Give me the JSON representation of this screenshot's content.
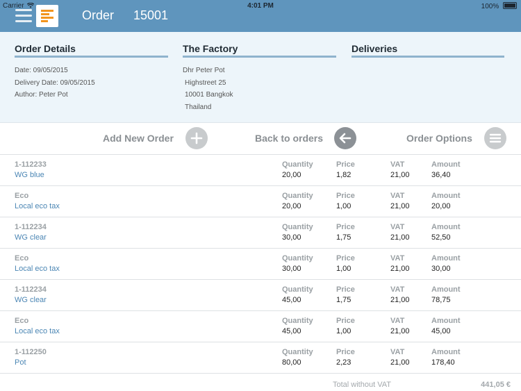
{
  "status_bar": {
    "carrier": "Carrier",
    "time": "4:01 PM",
    "battery": "100%"
  },
  "header": {
    "title": "Order",
    "order_number": "15001"
  },
  "order_details": {
    "heading": "Order Details",
    "lines": [
      "Date: 09/05/2015",
      "Delivery Date: 09/05/2015",
      "Author: Peter Pot"
    ]
  },
  "factory": {
    "heading": "The Factory",
    "lines": [
      "Dhr Peter Pot",
      "Highstreet 25",
      "10001 Bangkok",
      "Thailand"
    ]
  },
  "deliveries": {
    "heading": "Deliveries"
  },
  "actions": {
    "add_new_order": "Add New Order",
    "back_to_orders": "Back to orders",
    "order_options": "Order Options"
  },
  "columns": {
    "quantity": "Quantity",
    "price": "Price",
    "vat": "VAT",
    "amount": "Amount"
  },
  "rows": [
    {
      "code": "1-112233",
      "description": "WG blue",
      "quantity": "20,00",
      "price": "1,82",
      "vat": "21,00",
      "amount": "36,40"
    },
    {
      "code": "Eco",
      "description": "Local eco tax",
      "quantity": "20,00",
      "price": "1,00",
      "vat": "21,00",
      "amount": "20,00"
    },
    {
      "code": "1-112234",
      "description": "WG clear",
      "quantity": "30,00",
      "price": "1,75",
      "vat": "21,00",
      "amount": "52,50"
    },
    {
      "code": "Eco",
      "description": "Local eco tax",
      "quantity": "30,00",
      "price": "1,00",
      "vat": "21,00",
      "amount": "30,00"
    },
    {
      "code": "1-112234",
      "description": "WG clear",
      "quantity": "45,00",
      "price": "1,75",
      "vat": "21,00",
      "amount": "78,75"
    },
    {
      "code": "Eco",
      "description": "Local eco tax",
      "quantity": "45,00",
      "price": "1,00",
      "vat": "21,00",
      "amount": "45,00"
    },
    {
      "code": "1-112250",
      "description": "Pot",
      "quantity": "80,00",
      "price": "2,23",
      "vat": "21,00",
      "amount": "178,40"
    }
  ],
  "total": {
    "label": "Total without VAT",
    "value": "441,05 €"
  },
  "colors": {
    "header": "#5f95bd",
    "panel": "#edf5fa",
    "link": "#4b86b4",
    "accent": "#f2941e"
  },
  "icons": [
    "wifi-icon",
    "battery-icon",
    "menu-icon",
    "app-logo-icon",
    "plus-icon",
    "arrow-left-icon",
    "list-icon"
  ]
}
